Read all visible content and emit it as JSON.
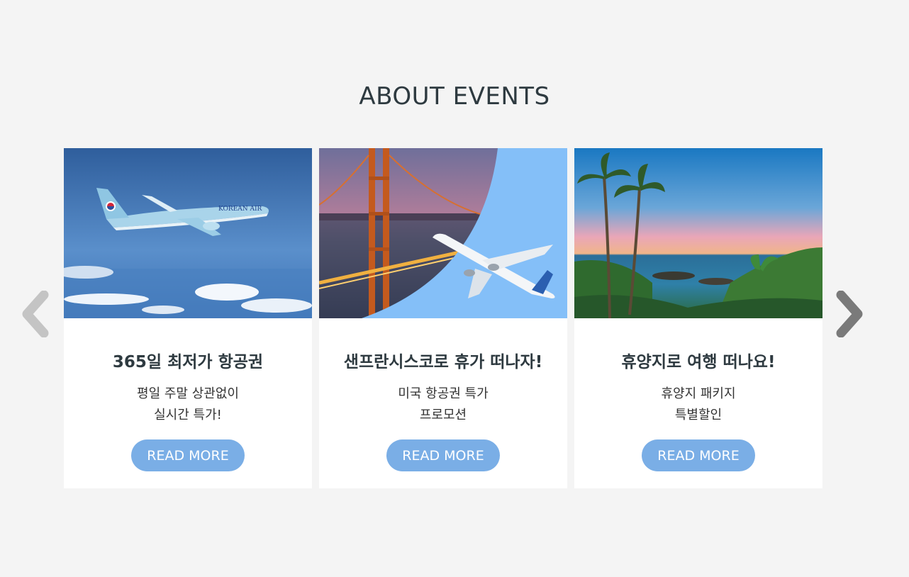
{
  "section": {
    "title": "ABOUT EVENTS"
  },
  "cards": [
    {
      "title": "365일 최저가 항공권",
      "desc_lines": [
        "평일 주말 상관없이",
        "실시간 특가!"
      ],
      "button": "READ MORE",
      "image": "korean-air-plane-over-clouds"
    },
    {
      "title": "샌프란시스코로 휴가 떠나자!",
      "desc_lines": [
        "미국 항공권 특가",
        "프로모션"
      ],
      "button": "READ MORE",
      "image": "golden-gate-bridge-and-plane"
    },
    {
      "title": "휴양지로 여행 떠나요!",
      "desc_lines": [
        "휴양지 패키지",
        "특별할인"
      ],
      "button": "READ MORE",
      "image": "palm-trees-seaside-sunset"
    }
  ],
  "nav": {
    "prev_icon": "chevron-left-icon",
    "next_icon": "chevron-right-icon"
  },
  "colors": {
    "background": "#f4f4f4",
    "button": "#7aaee6",
    "prev_arrow": "#c4c4c4",
    "next_arrow": "#7a7a7a"
  }
}
